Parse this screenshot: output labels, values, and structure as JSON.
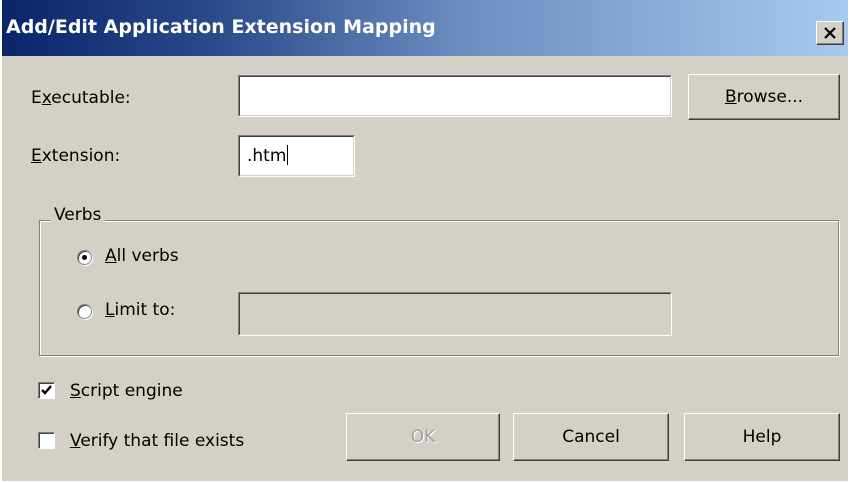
{
  "window": {
    "title": "Add/Edit Application Extension Mapping",
    "close_label": "×"
  },
  "executable": {
    "label_pre": "E",
    "label_ul": "x",
    "label_post": "ecutable:",
    "value": ""
  },
  "extension": {
    "label_pre": "",
    "label_ul": "E",
    "label_post": "xtension:",
    "value": ".htm"
  },
  "browse": {
    "label_ul": "B",
    "label_post": "rowse..."
  },
  "verbs": {
    "title": "Verbs",
    "all": {
      "label_ul": "A",
      "label_post": "ll verbs",
      "selected": true
    },
    "limit": {
      "label_ul": "L",
      "label_post": "imit to:",
      "selected": false,
      "value": ""
    }
  },
  "script_engine": {
    "label_ul": "S",
    "label_post": "cript engine",
    "checked": true
  },
  "verify": {
    "label_ul": "V",
    "label_post": "erify that file exists",
    "checked": false
  },
  "buttons": {
    "ok": "OK",
    "cancel": "Cancel",
    "help": "Help"
  }
}
